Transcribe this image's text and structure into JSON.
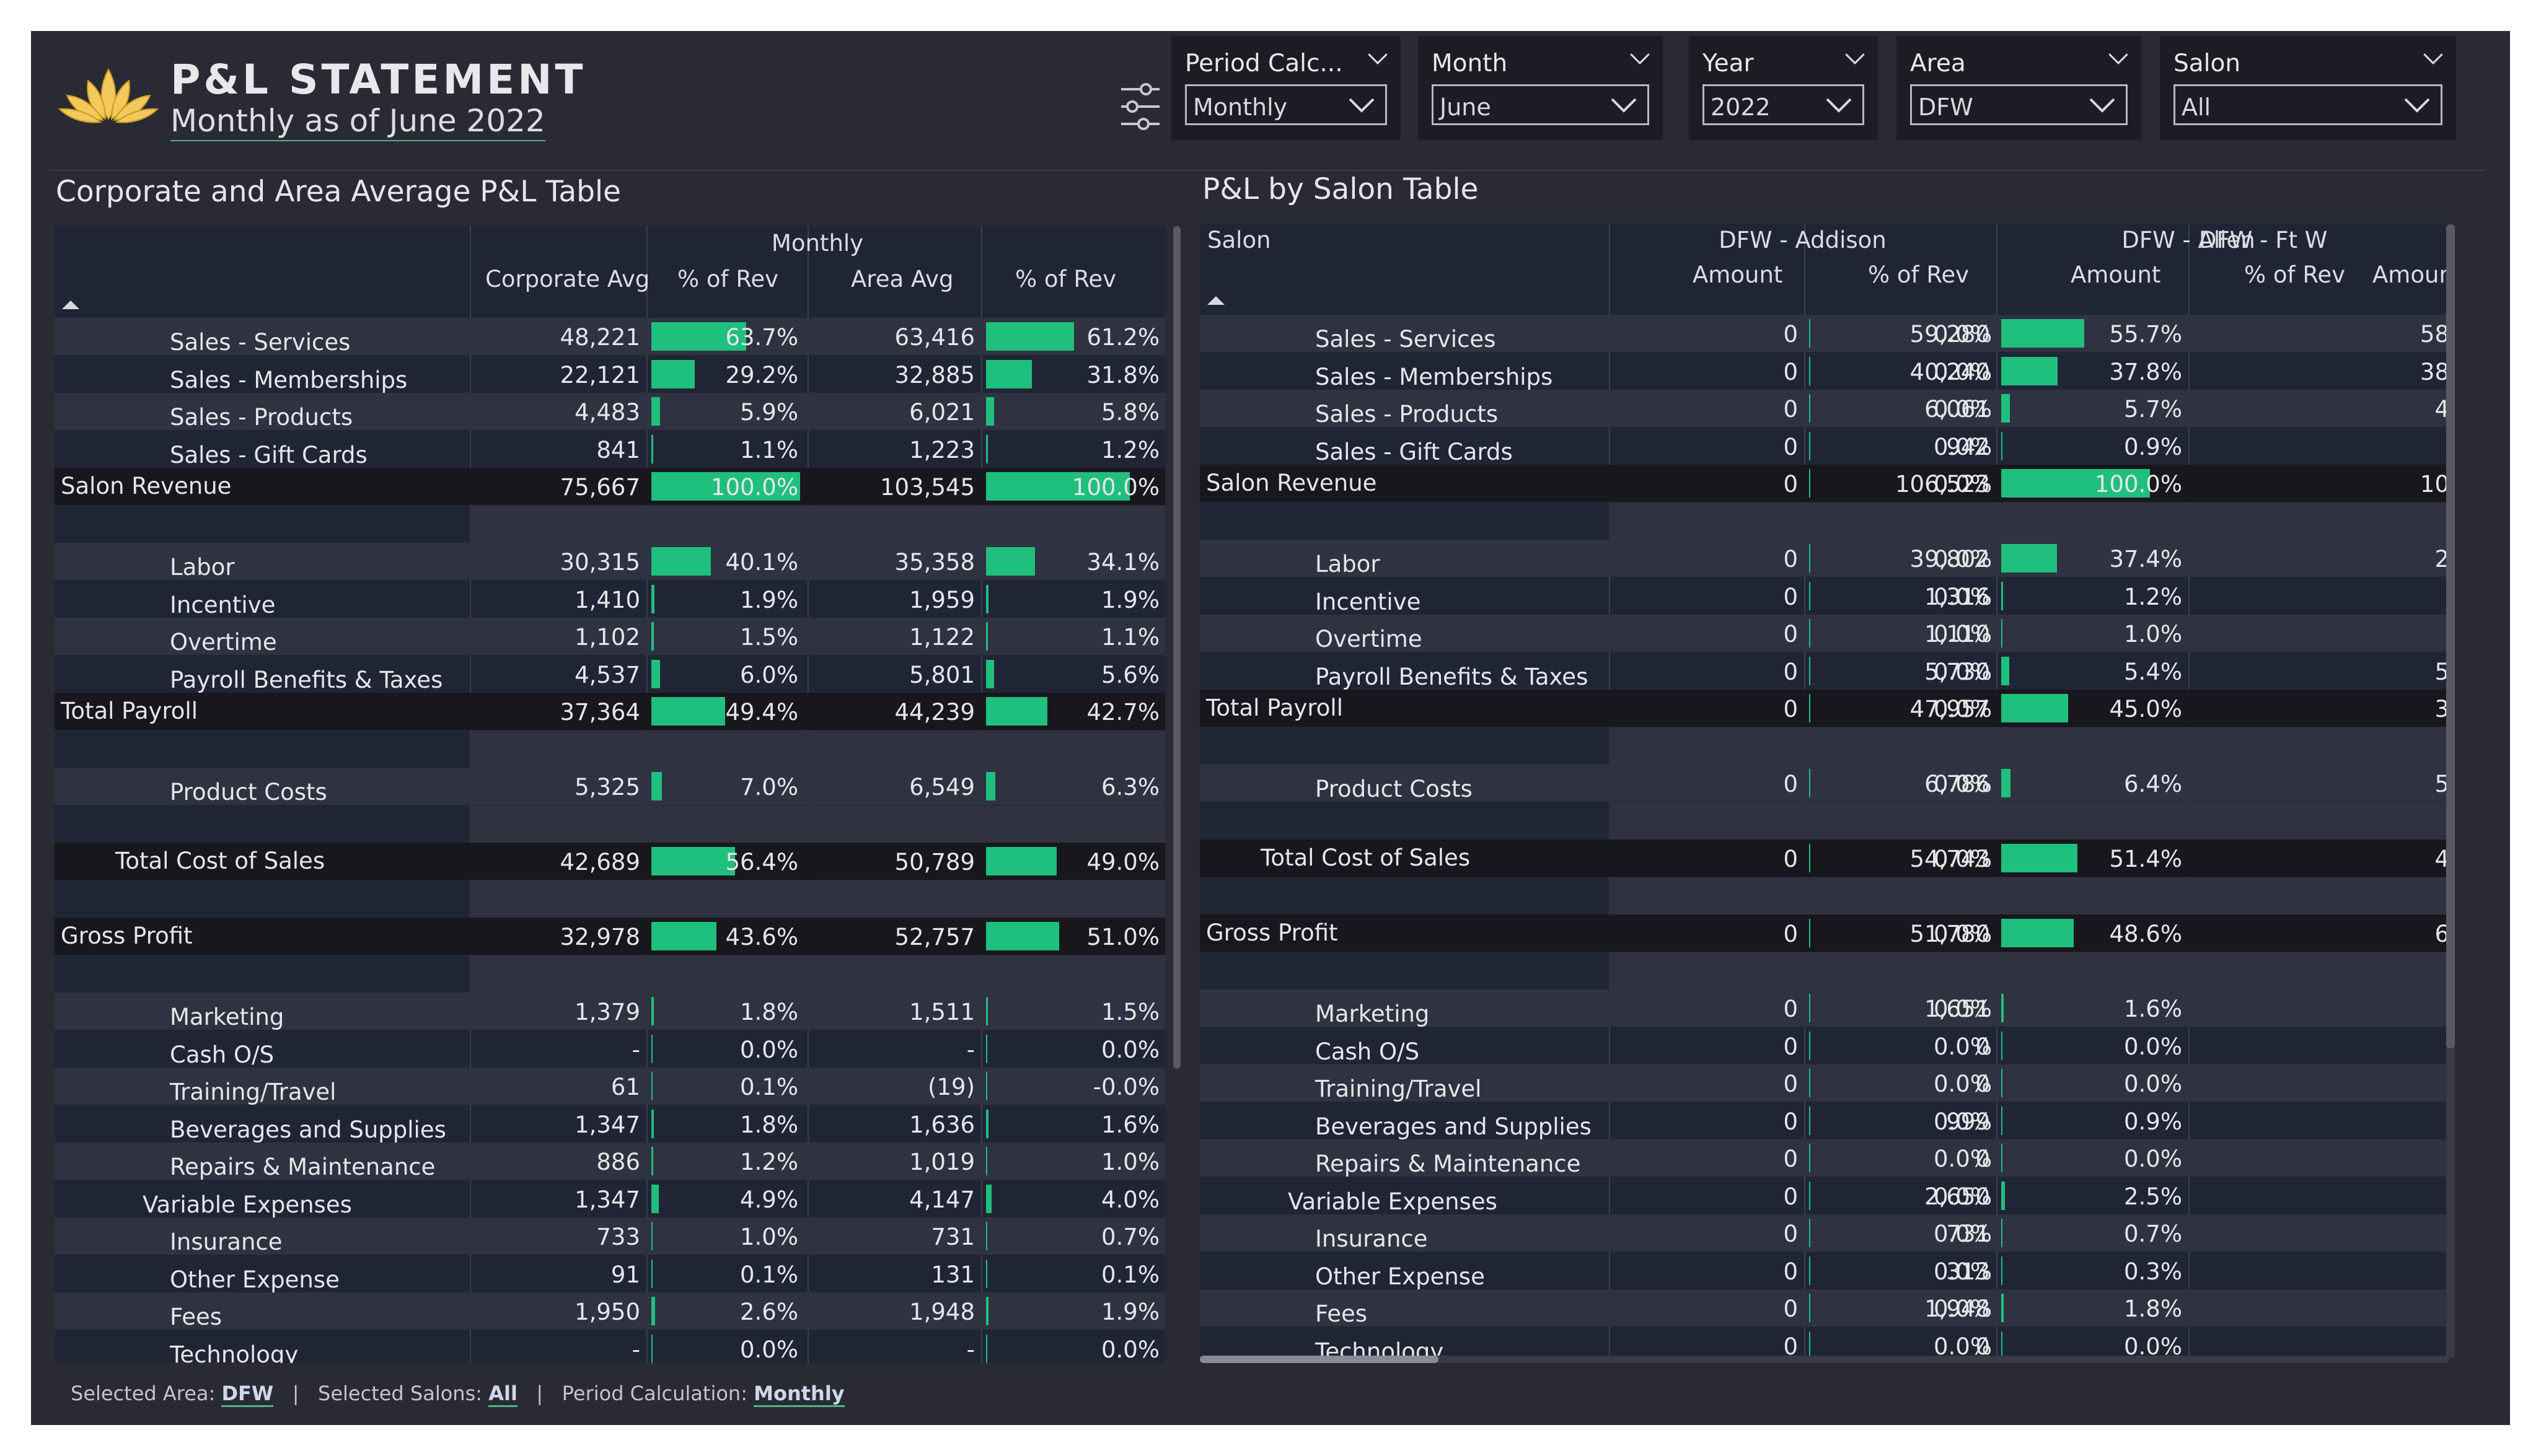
{
  "header": {
    "title": "P&L STATEMENT",
    "subtitle": "Monthly as of June 2022"
  },
  "slicers": [
    {
      "label": "Period Calc...",
      "value": "Monthly"
    },
    {
      "label": "Month",
      "value": "June"
    },
    {
      "label": "Year",
      "value": "2022"
    },
    {
      "label": "Area",
      "value": "DFW"
    },
    {
      "label": "Salon",
      "value": "All"
    }
  ],
  "left_table": {
    "title": "Corporate and Area Average P&L Table",
    "group_header": "Monthly",
    "columns": [
      "Corporate Avg",
      "% of Rev",
      "Area Avg",
      "% of Rev"
    ],
    "rows": [
      {
        "label": "Sales - Services",
        "values": [
          "48,221",
          "63.7%",
          "63,416",
          "61.2%"
        ],
        "pct": [
          63.7,
          61.2
        ],
        "indent": 2,
        "style": "alt"
      },
      {
        "label": "Sales - Memberships",
        "values": [
          "22,121",
          "29.2%",
          "32,885",
          "31.8%"
        ],
        "pct": [
          29.2,
          31.8
        ],
        "indent": 2,
        "style": "base"
      },
      {
        "label": "Sales - Products",
        "values": [
          "4,483",
          "5.9%",
          "6,021",
          "5.8%"
        ],
        "pct": [
          5.9,
          5.8
        ],
        "indent": 2,
        "style": "alt"
      },
      {
        "label": "Sales - Gift Cards",
        "values": [
          "841",
          "1.1%",
          "1,223",
          "1.2%"
        ],
        "pct": [
          1.1,
          1.2
        ],
        "indent": 2,
        "style": "base"
      },
      {
        "label": "Salon Revenue",
        "values": [
          "75,667",
          "100.0%",
          "103,545",
          "100.0%"
        ],
        "pct": [
          100.0,
          100.0
        ],
        "indent": 0,
        "style": "total"
      },
      {
        "label": "",
        "values": [
          "",
          "",
          "",
          ""
        ],
        "pct": [
          null,
          null
        ],
        "indent": 0,
        "style": "blank"
      },
      {
        "label": "Labor",
        "values": [
          "30,315",
          "40.1%",
          "35,358",
          "34.1%"
        ],
        "pct": [
          40.1,
          34.1
        ],
        "indent": 2,
        "style": "alt"
      },
      {
        "label": "Incentive",
        "values": [
          "1,410",
          "1.9%",
          "1,959",
          "1.9%"
        ],
        "pct": [
          1.9,
          1.9
        ],
        "indent": 2,
        "style": "base"
      },
      {
        "label": "Overtime",
        "values": [
          "1,102",
          "1.5%",
          "1,122",
          "1.1%"
        ],
        "pct": [
          1.5,
          1.1
        ],
        "indent": 2,
        "style": "alt"
      },
      {
        "label": "Payroll Benefits & Taxes",
        "values": [
          "4,537",
          "6.0%",
          "5,801",
          "5.6%"
        ],
        "pct": [
          6.0,
          5.6
        ],
        "indent": 2,
        "style": "base"
      },
      {
        "label": "Total Payroll",
        "values": [
          "37,364",
          "49.4%",
          "44,239",
          "42.7%"
        ],
        "pct": [
          49.4,
          42.7
        ],
        "indent": 0,
        "style": "total"
      },
      {
        "label": "",
        "values": [
          "",
          "",
          "",
          ""
        ],
        "pct": [
          null,
          null
        ],
        "indent": 0,
        "style": "blank"
      },
      {
        "label": "Product Costs",
        "values": [
          "5,325",
          "7.0%",
          "6,549",
          "6.3%"
        ],
        "pct": [
          7.0,
          6.3
        ],
        "indent": 2,
        "style": "alt"
      },
      {
        "label": "",
        "values": [
          "",
          "",
          "",
          ""
        ],
        "pct": [
          null,
          null
        ],
        "indent": 0,
        "style": "blank"
      },
      {
        "label": "Total Cost of Sales",
        "values": [
          "42,689",
          "56.4%",
          "50,789",
          "49.0%"
        ],
        "pct": [
          56.4,
          49.0
        ],
        "indent": 1,
        "style": "total"
      },
      {
        "label": "",
        "values": [
          "",
          "",
          "",
          ""
        ],
        "pct": [
          null,
          null
        ],
        "indent": 0,
        "style": "blank"
      },
      {
        "label": "Gross Profit",
        "values": [
          "32,978",
          "43.6%",
          "52,757",
          "51.0%"
        ],
        "pct": [
          43.6,
          51.0
        ],
        "indent": 0,
        "style": "total"
      },
      {
        "label": "",
        "values": [
          "",
          "",
          "",
          ""
        ],
        "pct": [
          null,
          null
        ],
        "indent": 0,
        "style": "blank"
      },
      {
        "label": "Marketing",
        "values": [
          "1,379",
          "1.8%",
          "1,511",
          "1.5%"
        ],
        "pct": [
          1.8,
          1.5
        ],
        "indent": 2,
        "style": "alt"
      },
      {
        "label": "Cash O/S",
        "values": [
          "-",
          "0.0%",
          "-",
          "0.0%"
        ],
        "pct": [
          0.0,
          0.0
        ],
        "indent": 2,
        "style": "base"
      },
      {
        "label": "Training/Travel",
        "values": [
          "61",
          "0.1%",
          "(19)",
          "-0.0%"
        ],
        "pct": [
          0.1,
          0.0
        ],
        "indent": 2,
        "style": "alt"
      },
      {
        "label": "Beverages and Supplies",
        "values": [
          "1,347",
          "1.8%",
          "1,636",
          "1.6%"
        ],
        "pct": [
          1.8,
          1.6
        ],
        "indent": 2,
        "style": "base"
      },
      {
        "label": "Repairs & Maintenance",
        "values": [
          "886",
          "1.2%",
          "1,019",
          "1.0%"
        ],
        "pct": [
          1.2,
          1.0
        ],
        "indent": 2,
        "style": "alt"
      },
      {
        "label": "Variable Expenses",
        "values": [
          "1,347",
          "4.9%",
          "4,147",
          "4.0%"
        ],
        "pct": [
          4.9,
          4.0
        ],
        "indent": 1.5,
        "style": "base"
      },
      {
        "label": "Insurance",
        "values": [
          "733",
          "1.0%",
          "731",
          "0.7%"
        ],
        "pct": [
          1.0,
          0.7
        ],
        "indent": 2,
        "style": "alt"
      },
      {
        "label": "Other Expense",
        "values": [
          "91",
          "0.1%",
          "131",
          "0.1%"
        ],
        "pct": [
          0.1,
          0.1
        ],
        "indent": 2,
        "style": "base"
      },
      {
        "label": "Fees",
        "values": [
          "1,950",
          "2.6%",
          "1,948",
          "1.9%"
        ],
        "pct": [
          2.6,
          1.9
        ],
        "indent": 2,
        "style": "alt"
      },
      {
        "label": "Technology",
        "values": [
          "-",
          "0.0%",
          "-",
          "0.0%"
        ],
        "pct": [
          0.0,
          0.0
        ],
        "indent": 2,
        "style": "base"
      }
    ]
  },
  "right_table": {
    "title": "P&L by Salon Table",
    "row_header": "Salon",
    "groups": [
      "DFW - Addison",
      "DFW - Allen",
      "DFW - Ft W"
    ],
    "columns": [
      "Amount",
      "% of Rev",
      "Amount",
      "% of Rev",
      "Amoun"
    ],
    "rows": [
      {
        "label": "Sales - Services",
        "values": [
          "0",
          "0.0%",
          "59,280",
          "55.7%",
          "58"
        ],
        "pct": [
          0.0,
          55.7
        ],
        "indent": 2,
        "style": "alt"
      },
      {
        "label": "Sales - Memberships",
        "values": [
          "0",
          "0.0%",
          "40,240",
          "37.8%",
          "38"
        ],
        "pct": [
          0.0,
          37.8
        ],
        "indent": 2,
        "style": "base"
      },
      {
        "label": "Sales - Products",
        "values": [
          "0",
          "0.0%",
          "6,061",
          "5.7%",
          "4"
        ],
        "pct": [
          0.0,
          5.7
        ],
        "indent": 2,
        "style": "alt"
      },
      {
        "label": "Sales - Gift Cards",
        "values": [
          "0",
          "0.0%",
          "942",
          "0.9%",
          ""
        ],
        "pct": [
          0.0,
          0.9
        ],
        "indent": 2,
        "style": "base"
      },
      {
        "label": "Salon Revenue",
        "values": [
          "0",
          "0.0%",
          "106,523",
          "100.0%",
          "10"
        ],
        "pct": [
          0.0,
          100.0
        ],
        "indent": 0,
        "style": "total"
      },
      {
        "label": "",
        "values": [
          "",
          "",
          "",
          "",
          ""
        ],
        "pct": [
          null,
          null
        ],
        "indent": 0,
        "style": "blank"
      },
      {
        "label": "Labor",
        "values": [
          "0",
          "0.0%",
          "39,802",
          "37.4%",
          "2"
        ],
        "pct": [
          0.0,
          37.4
        ],
        "indent": 2,
        "style": "alt"
      },
      {
        "label": "Incentive",
        "values": [
          "0",
          "0.0%",
          "1,316",
          "1.2%",
          ""
        ],
        "pct": [
          0.0,
          1.2
        ],
        "indent": 2,
        "style": "base"
      },
      {
        "label": "Overtime",
        "values": [
          "0",
          "0.0%",
          "1,110",
          "1.0%",
          ""
        ],
        "pct": [
          0.0,
          1.0
        ],
        "indent": 2,
        "style": "alt"
      },
      {
        "label": "Payroll Benefits & Taxes",
        "values": [
          "0",
          "0.0%",
          "5,730",
          "5.4%",
          "5"
        ],
        "pct": [
          0.0,
          5.4
        ],
        "indent": 2,
        "style": "base"
      },
      {
        "label": "Total Payroll",
        "values": [
          "0",
          "0.0%",
          "47,957",
          "45.0%",
          "3"
        ],
        "pct": [
          0.0,
          45.0
        ],
        "indent": 0,
        "style": "total"
      },
      {
        "label": "",
        "values": [
          "",
          "",
          "",
          "",
          ""
        ],
        "pct": [
          null,
          null
        ],
        "indent": 0,
        "style": "blank"
      },
      {
        "label": "Product Costs",
        "values": [
          "0",
          "0.0%",
          "6,786",
          "6.4%",
          "5"
        ],
        "pct": [
          0.0,
          6.4
        ],
        "indent": 2,
        "style": "alt"
      },
      {
        "label": "",
        "values": [
          "",
          "",
          "",
          "",
          ""
        ],
        "pct": [
          null,
          null
        ],
        "indent": 0,
        "style": "blank"
      },
      {
        "label": "Total Cost of Sales",
        "values": [
          "0",
          "0.0%",
          "54,743",
          "51.4%",
          "4"
        ],
        "pct": [
          0.0,
          51.4
        ],
        "indent": 1,
        "style": "total"
      },
      {
        "label": "",
        "values": [
          "",
          "",
          "",
          "",
          ""
        ],
        "pct": [
          null,
          null
        ],
        "indent": 0,
        "style": "blank"
      },
      {
        "label": "Gross Profit",
        "values": [
          "0",
          "0.0%",
          "51,780",
          "48.6%",
          "6"
        ],
        "pct": [
          0.0,
          48.6
        ],
        "indent": 0,
        "style": "total"
      },
      {
        "label": "",
        "values": [
          "",
          "",
          "",
          "",
          ""
        ],
        "pct": [
          null,
          null
        ],
        "indent": 0,
        "style": "blank"
      },
      {
        "label": "Marketing",
        "values": [
          "0",
          "0.0%",
          "1,651",
          "1.6%",
          ""
        ],
        "pct": [
          0.0,
          1.6
        ],
        "indent": 2,
        "style": "alt"
      },
      {
        "label": "Cash O/S",
        "values": [
          "0",
          "0.0%",
          "0",
          "0.0%",
          ""
        ],
        "pct": [
          0.0,
          0.0
        ],
        "indent": 2,
        "style": "base"
      },
      {
        "label": "Training/Travel",
        "values": [
          "0",
          "0.0%",
          "0",
          "0.0%",
          ""
        ],
        "pct": [
          0.0,
          0.0
        ],
        "indent": 2,
        "style": "alt"
      },
      {
        "label": "Beverages and Supplies",
        "values": [
          "0",
          "0.0%",
          "999",
          "0.9%",
          ""
        ],
        "pct": [
          0.0,
          0.9
        ],
        "indent": 2,
        "style": "base"
      },
      {
        "label": "Repairs & Maintenance",
        "values": [
          "0",
          "0.0%",
          "0",
          "0.0%",
          ""
        ],
        "pct": [
          0.0,
          0.0
        ],
        "indent": 2,
        "style": "alt"
      },
      {
        "label": "Variable Expenses",
        "values": [
          "0",
          "0.0%",
          "2,650",
          "2.5%",
          ""
        ],
        "pct": [
          0.0,
          2.5
        ],
        "indent": 1.5,
        "style": "base"
      },
      {
        "label": "Insurance",
        "values": [
          "0",
          "0.0%",
          "731",
          "0.7%",
          ""
        ],
        "pct": [
          0.0,
          0.7
        ],
        "indent": 2,
        "style": "alt"
      },
      {
        "label": "Other Expense",
        "values": [
          "0",
          "0.0%",
          "313",
          "0.3%",
          ""
        ],
        "pct": [
          0.0,
          0.3
        ],
        "indent": 2,
        "style": "base"
      },
      {
        "label": "Fees",
        "values": [
          "0",
          "0.0%",
          "1,948",
          "1.8%",
          ""
        ],
        "pct": [
          0.0,
          1.8
        ],
        "indent": 2,
        "style": "alt"
      },
      {
        "label": "Technology",
        "values": [
          "0",
          "0.0%",
          "0",
          "0.0%",
          ""
        ],
        "pct": [
          0.0,
          0.0
        ],
        "indent": 2,
        "style": "base"
      }
    ]
  },
  "footer": {
    "area_label": "Selected Area:",
    "area_value": "DFW",
    "sep1": "|",
    "salons_label": "Selected Salons:",
    "salons_value": "All",
    "sep2": "|",
    "period_label": "Period Calculation:",
    "period_value": "Monthly"
  },
  "colors": {
    "bar": "#1fbf7e",
    "canvas": "#2a2a35",
    "table_bg": "#1f2535",
    "row_alt": "#2f3240",
    "row_total": "#17171d",
    "row_blank": "#30333f"
  },
  "icons": [
    "lotus-logo-icon",
    "filter-sliders-icon",
    "chevron-down-icon",
    "sort-ascending-icon"
  ]
}
